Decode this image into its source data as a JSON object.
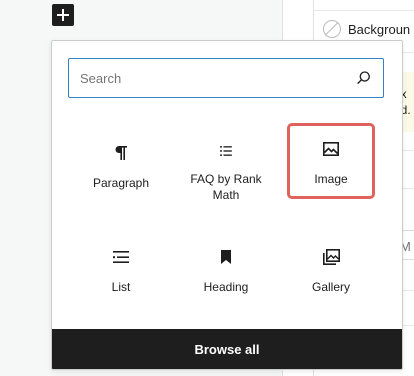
{
  "toolbar": {
    "add_block_icon": "plus-icon"
  },
  "sidebar": {
    "background_label": "Backgroun",
    "notice_lines": [
      "ex",
      "ad."
    ],
    "m_fragment": "M"
  },
  "inserter": {
    "search": {
      "placeholder": "Search",
      "value": ""
    },
    "blocks": [
      {
        "label": "Paragraph",
        "icon": "paragraph-icon"
      },
      {
        "label": "FAQ by Rank Math",
        "icon": "list-icon"
      },
      {
        "label": "Image",
        "icon": "image-icon",
        "highlighted": true
      },
      {
        "label": "List",
        "icon": "list-icon"
      },
      {
        "label": "Heading",
        "icon": "bookmark-icon"
      },
      {
        "label": "Gallery",
        "icon": "gallery-icon"
      }
    ],
    "browse_all": "Browse all"
  },
  "colors": {
    "accent": "#3582c4",
    "highlight": "#e0625d",
    "footer": "#1e1e1e"
  }
}
